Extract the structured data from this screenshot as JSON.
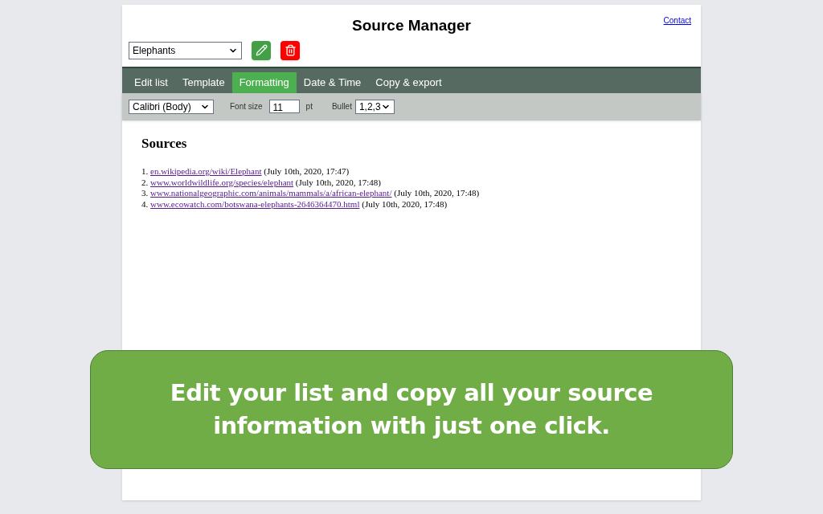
{
  "header": {
    "title": "Source Manager",
    "contact_link": "Contact",
    "list_select": {
      "value": "Elephants"
    }
  },
  "tabs": [
    {
      "label": "Edit list",
      "selected": false
    },
    {
      "label": "Template",
      "selected": false
    },
    {
      "label": "Formatting",
      "selected": true
    },
    {
      "label": "Date & Time",
      "selected": false
    },
    {
      "label": "Copy & export",
      "selected": false
    }
  ],
  "toolbar": {
    "font_select": {
      "value": "Calibri (Body)"
    },
    "font_size_label": "Font size",
    "font_size": "11",
    "unit": "pt",
    "bullet_label": "Bullet",
    "bullet_select": {
      "value": "1,2,3"
    }
  },
  "sources": {
    "heading": "Sources",
    "items": [
      {
        "number": "1.",
        "link": "en.wikipedia.org/wiki/Elephant",
        "date": "(July 10th, 2020, 17:47)"
      },
      {
        "number": "2.",
        "link": "www.worldwildlife.org/species/elephant",
        "date": "(July 10th, 2020, 17:48)"
      },
      {
        "number": "3.",
        "link": "www.nationalgeographic.com/animals/mammals/a/african-elephant/",
        "date": "(July 10th, 2020, 17:48)"
      },
      {
        "number": "4.",
        "link": "www.ecowatch.com/botswana-elephants-2646364470.html",
        "date": "(July 10th, 2020, 17:48)"
      }
    ]
  },
  "callout": {
    "text": "Edit your list and copy all your source information with just one click."
  }
}
